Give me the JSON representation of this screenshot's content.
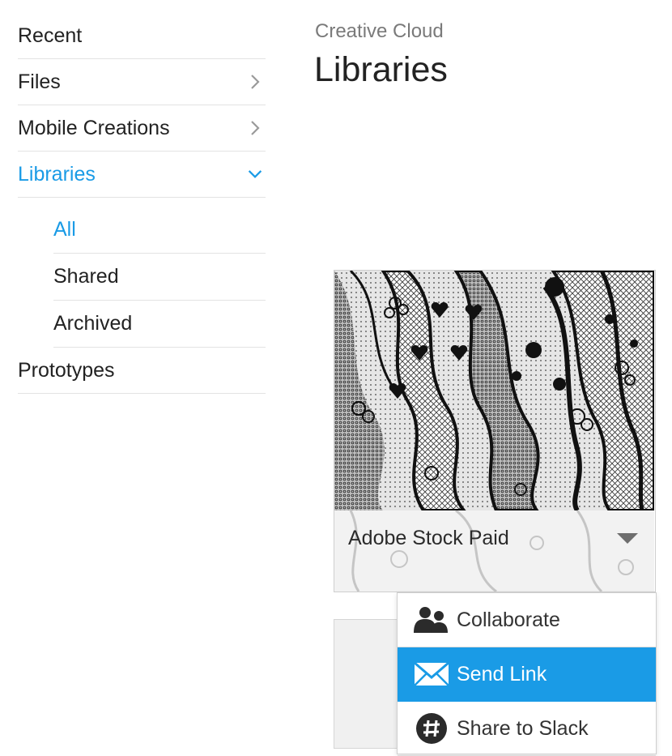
{
  "sidebar": {
    "items": [
      {
        "label": "Recent"
      },
      {
        "label": "Files"
      },
      {
        "label": "Mobile Creations"
      },
      {
        "label": "Libraries"
      },
      {
        "label": "All"
      },
      {
        "label": "Shared"
      },
      {
        "label": "Archived"
      },
      {
        "label": "Prototypes"
      }
    ]
  },
  "header": {
    "subtitle": "Creative Cloud",
    "title": "Libraries"
  },
  "library_card": {
    "name": "Adobe Stock Paid"
  },
  "context_menu": {
    "items": [
      {
        "label": "Collaborate",
        "icon": "collaborate-icon"
      },
      {
        "label": "Send Link",
        "icon": "envelope-icon"
      },
      {
        "label": "Share to Slack",
        "icon": "slack-icon"
      }
    ],
    "selected_index": 1
  },
  "colors": {
    "accent": "#1a9be6",
    "text": "#222222",
    "muted": "#7a7a7a"
  }
}
